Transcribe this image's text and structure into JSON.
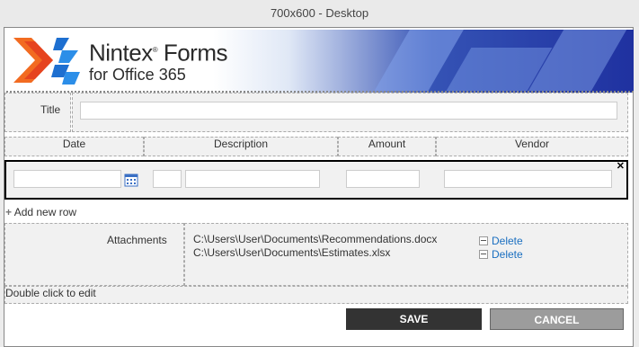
{
  "window": {
    "title": "700x600 - Desktop"
  },
  "banner": {
    "brand": "Nintex",
    "product": "Forms",
    "subtitle": "for Office 365"
  },
  "form": {
    "title_label": "Title",
    "title_value": "",
    "columns": [
      "Date",
      "Description",
      "Amount",
      "Vendor"
    ],
    "add_row_label": "Add new row",
    "attachments_label": "Attachments",
    "attachments": [
      {
        "path": "C:\\Users\\User\\Documents\\Recommendations.docx",
        "action": "Delete"
      },
      {
        "path": "C:\\Users\\User\\Documents\\Estimates.xlsx",
        "action": "Delete"
      }
    ],
    "edit_hint": "Double click to edit"
  },
  "buttons": {
    "save": "SAVE",
    "cancel": "CANCEL"
  },
  "colors": {
    "save_bg": "#333333",
    "cancel_bg": "#999999",
    "link": "#1a6fc0"
  }
}
